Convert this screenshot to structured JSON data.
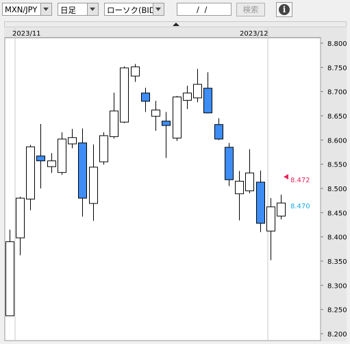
{
  "toolbar": {
    "currency_pair": "MXN/JPY",
    "timeframe": "日足",
    "chart_type": "ローソク(BID)",
    "date_input": "/ /",
    "search_label": "検索",
    "info_symbol": "i"
  },
  "chart_data": {
    "type": "candlestick",
    "x_labels": [
      "2023/11",
      "2023/12"
    ],
    "y_ticks": [
      "8.800",
      "8.750",
      "8.700",
      "8.650",
      "8.600",
      "8.550",
      "8.500",
      "8.450",
      "8.400",
      "8.350",
      "8.300",
      "8.250",
      "8.200"
    ],
    "ylim": [
      8.2,
      8.8
    ],
    "colors": {
      "up_fill": "#ffffff",
      "down_fill": "#3d8df5",
      "outline": "#000000"
    },
    "ohlc": [
      [
        8.237,
        8.415,
        8.237,
        8.39
      ],
      [
        8.398,
        8.483,
        8.362,
        8.48
      ],
      [
        8.478,
        8.59,
        8.455,
        8.586
      ],
      [
        8.567,
        8.633,
        8.5,
        8.557
      ],
      [
        8.545,
        8.573,
        8.532,
        8.557
      ],
      [
        8.533,
        8.616,
        8.528,
        8.602
      ],
      [
        8.592,
        8.623,
        8.583,
        8.605
      ],
      [
        8.594,
        8.624,
        8.442,
        8.48
      ],
      [
        8.469,
        8.591,
        8.433,
        8.544
      ],
      [
        8.555,
        8.616,
        8.549,
        8.609
      ],
      [
        8.607,
        8.698,
        8.603,
        8.66
      ],
      [
        8.637,
        8.752,
        8.635,
        8.749
      ],
      [
        8.732,
        8.757,
        8.72,
        8.751
      ],
      [
        8.697,
        8.708,
        8.658,
        8.68
      ],
      [
        8.649,
        8.681,
        8.619,
        8.662
      ],
      [
        8.639,
        8.658,
        8.563,
        8.63
      ],
      [
        8.604,
        8.691,
        8.598,
        8.689
      ],
      [
        8.682,
        8.712,
        8.664,
        8.697
      ],
      [
        8.687,
        8.747,
        8.678,
        8.715
      ],
      [
        8.707,
        8.74,
        8.655,
        8.656
      ],
      [
        8.632,
        8.645,
        8.6,
        8.602
      ],
      [
        8.585,
        8.594,
        8.505,
        8.518
      ],
      [
        8.489,
        8.536,
        8.434,
        8.515
      ],
      [
        8.495,
        8.581,
        8.49,
        8.532
      ],
      [
        8.513,
        8.537,
        8.41,
        8.428
      ],
      [
        8.412,
        8.48,
        8.352,
        8.462
      ],
      [
        8.443,
        8.487,
        8.436,
        8.47
      ]
    ],
    "bid_price": "8.472",
    "ask_price": "8.470",
    "bid_color": "#e8245e",
    "ask_color": "#1aa8df"
  }
}
